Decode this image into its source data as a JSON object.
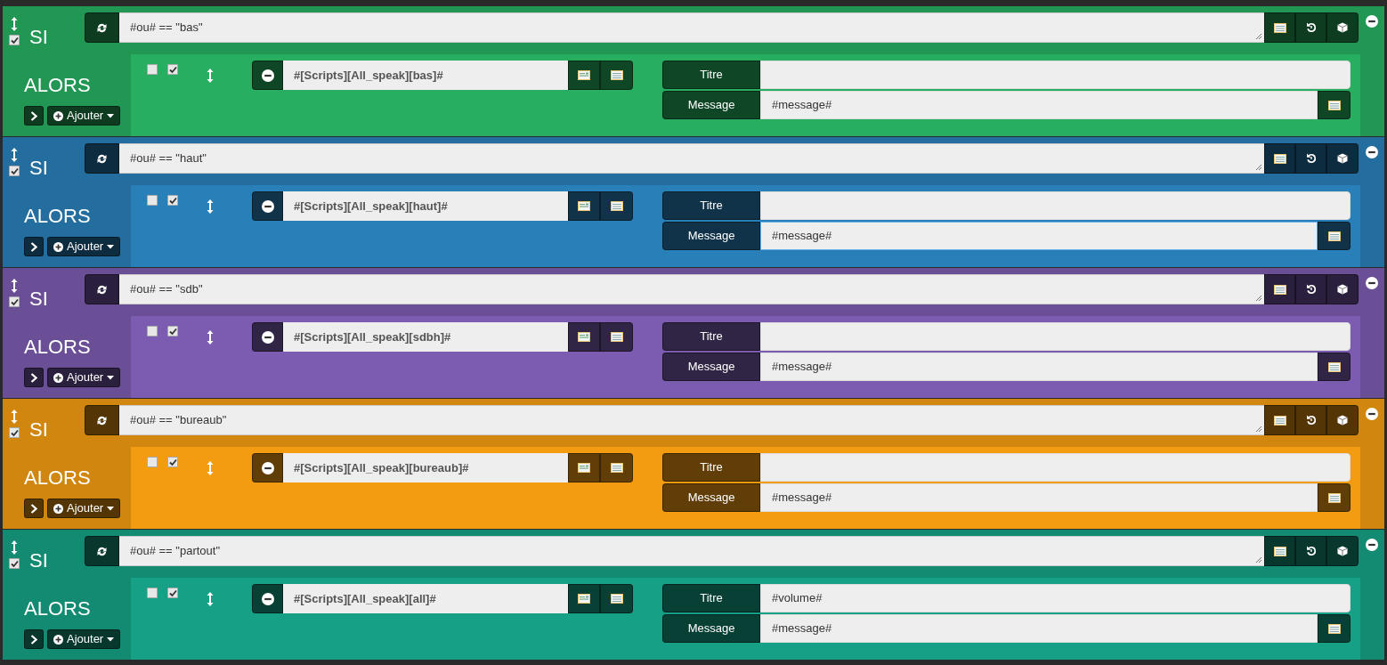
{
  "blocks": [
    {
      "color": "#27ae60",
      "checked": true,
      "si_label": "SI",
      "condition": "#ou# == \"bas\"",
      "alors_label": "ALORS",
      "add_button": "Ajouter",
      "action": {
        "options": [
          {
            "checked": false
          },
          {
            "checked": true
          }
        ],
        "command": "#[Scripts][All_speak][bas]#",
        "fields": [
          {
            "kind": "plain",
            "label": "Titre"
          },
          {
            "kind": "with_button",
            "label": "Message",
            "value": "#message#",
            "focused": false
          }
        ]
      }
    },
    {
      "color": "#2980b9",
      "checked": true,
      "si_label": "SI",
      "condition": "#ou# == \"haut\"",
      "alors_label": "ALORS",
      "add_button": "Ajouter",
      "action": {
        "options": [
          {
            "checked": false
          },
          {
            "checked": true
          }
        ],
        "command": "#[Scripts][All_speak][haut]#",
        "fields": [
          {
            "kind": "plain",
            "label": "Titre"
          },
          {
            "kind": "with_button",
            "label": "Message",
            "value": "#message#",
            "focused": true
          }
        ]
      }
    },
    {
      "color": "#7b5cb0",
      "checked": true,
      "si_label": "SI",
      "condition": "#ou# == \"sdb\"",
      "alors_label": "ALORS",
      "add_button": "Ajouter",
      "action": {
        "options": [
          {
            "checked": false
          },
          {
            "checked": true
          }
        ],
        "command": "#[Scripts][All_speak][sdbh]#",
        "fields": [
          {
            "kind": "plain",
            "label": "Titre"
          },
          {
            "kind": "with_button",
            "label": "Message",
            "value": "#message#",
            "focused": false
          }
        ]
      }
    },
    {
      "color": "#f39c12",
      "checked": true,
      "si_label": "SI",
      "condition": "#ou# == \"bureaub\"",
      "alors_label": "ALORS",
      "add_button": "Ajouter",
      "action": {
        "options": [
          {
            "checked": false
          },
          {
            "checked": true
          }
        ],
        "command": "#[Scripts][All_speak][bureaub]#",
        "fields": [
          {
            "kind": "plain",
            "label": "Titre"
          },
          {
            "kind": "with_button",
            "label": "Message",
            "value": "#message#",
            "focused": false
          }
        ]
      }
    },
    {
      "color": "#16a085",
      "checked": true,
      "si_label": "SI",
      "condition": "#ou# == \"partout\"",
      "alors_label": "ALORS",
      "add_button": "Ajouter",
      "action": {
        "options": [
          {
            "checked": false
          },
          {
            "checked": true
          }
        ],
        "command": "#[Scripts][All_speak][all]#",
        "fields": [
          {
            "kind": "plain",
            "label": "Titre",
            "value": "#volume#"
          },
          {
            "kind": "with_button",
            "label": "Message",
            "value": "#message#",
            "focused": false
          }
        ]
      }
    }
  ]
}
